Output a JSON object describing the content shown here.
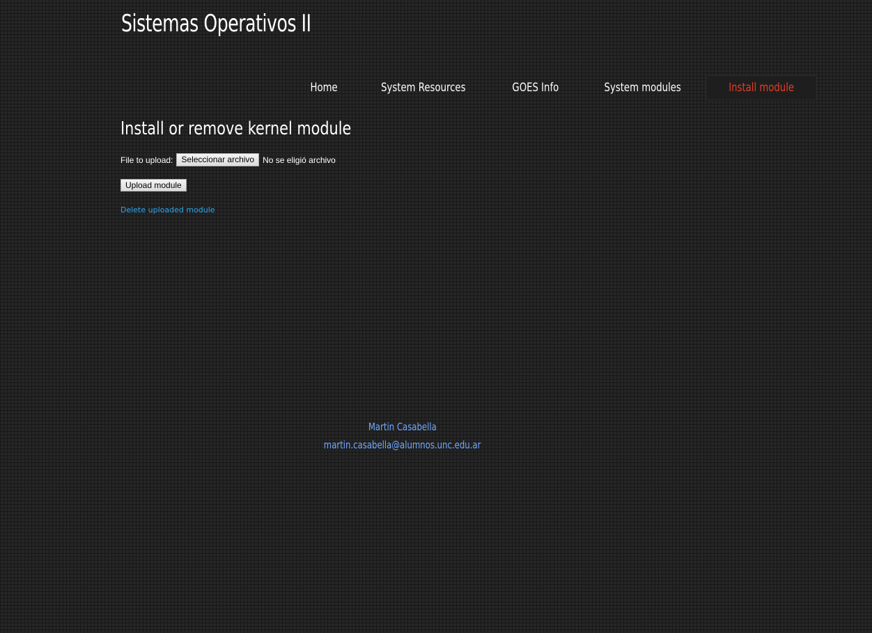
{
  "site": {
    "title": "Sistemas Operativos II"
  },
  "nav": {
    "items": [
      {
        "label": "Home"
      },
      {
        "label": "System Resources"
      },
      {
        "label": "GOES Info"
      },
      {
        "label": "System modules"
      },
      {
        "label": "Install module",
        "active": true
      }
    ]
  },
  "main": {
    "heading": "Install or remove kernel module",
    "upload_label": "File to upload:",
    "file_button_label": "Seleccionar archivo",
    "file_status": "No se eligió archivo",
    "upload_button_label": "Upload module",
    "delete_link_label": "Delete uploaded module"
  },
  "footer": {
    "name": "Martin Casabella",
    "email": "martin.casabella@alumnos.unc.edu.ar"
  },
  "colors": {
    "background": "#262626",
    "active_nav": "#e23d28",
    "link": "#2aa7f0",
    "footer_text": "#6fa8ff"
  }
}
